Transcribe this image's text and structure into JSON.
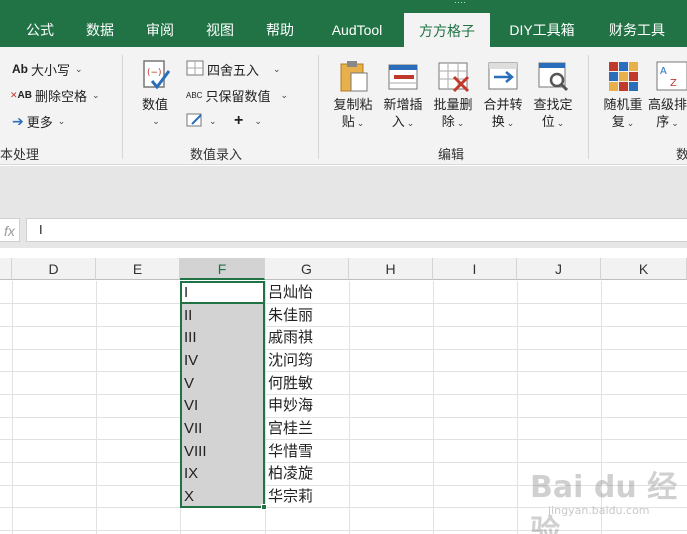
{
  "tabs": [
    {
      "label": "公式",
      "active": false
    },
    {
      "label": "数据",
      "active": false
    },
    {
      "label": "审阅",
      "active": false
    },
    {
      "label": "视图",
      "active": false
    },
    {
      "label": "帮助",
      "active": false
    },
    {
      "label": "AudTool",
      "active": false
    },
    {
      "label": "方方格子",
      "active": true
    },
    {
      "label": "DIY工具箱",
      "active": false
    },
    {
      "label": "财务工具",
      "active": false
    }
  ],
  "ribbon": {
    "text_group": {
      "label": "本处理",
      "case_btn": "大小写",
      "case_icon_text": "Ab",
      "trim_btn": "删除空格",
      "trim_icon_text": "AB",
      "more_btn": "更多"
    },
    "value_group": {
      "label": "数值录入",
      "value_btn": "数值",
      "round_btn": "四舍五入",
      "keep_btn": "只保留数值",
      "keep_icon_text": "ABC"
    },
    "edit_group": {
      "label": "编辑",
      "buttons": [
        {
          "l1": "复制粘",
          "l2": "贴"
        },
        {
          "l1": "新增插",
          "l2": "入"
        },
        {
          "l1": "批量删",
          "l2": "除"
        },
        {
          "l1": "合并转",
          "l2": "换"
        },
        {
          "l1": "查找定",
          "l2": "位"
        }
      ]
    },
    "data_group": {
      "label": "数",
      "buttons": [
        {
          "l1": "随机重",
          "l2": "复"
        },
        {
          "l1": "高级排",
          "l2": "序"
        }
      ]
    }
  },
  "formula_bar": {
    "fx": "fx",
    "value": "I"
  },
  "columns": [
    "D",
    "E",
    "F",
    "G",
    "H",
    "I",
    "J",
    "K"
  ],
  "selected_column": "F",
  "rows": [
    {
      "f": "I",
      "g": "吕灿怡"
    },
    {
      "f": "II",
      "g": "朱佳丽"
    },
    {
      "f": "III",
      "g": "戚雨祺"
    },
    {
      "f": "IV",
      "g": "沈问筠"
    },
    {
      "f": "V",
      "g": "何胜敏"
    },
    {
      "f": "VI",
      "g": "申妙海"
    },
    {
      "f": "VII",
      "g": "宫桂兰"
    },
    {
      "f": "VIII",
      "g": "华惜雪"
    },
    {
      "f": "IX",
      "g": "柏凌旋"
    },
    {
      "f": "X",
      "g": "华宗莉"
    }
  ],
  "colors": {
    "brand": "#217346",
    "selection": "#d3d3d3"
  },
  "watermark": {
    "logo": "Bai du 经验",
    "url": "jingyan.baidu.com"
  }
}
